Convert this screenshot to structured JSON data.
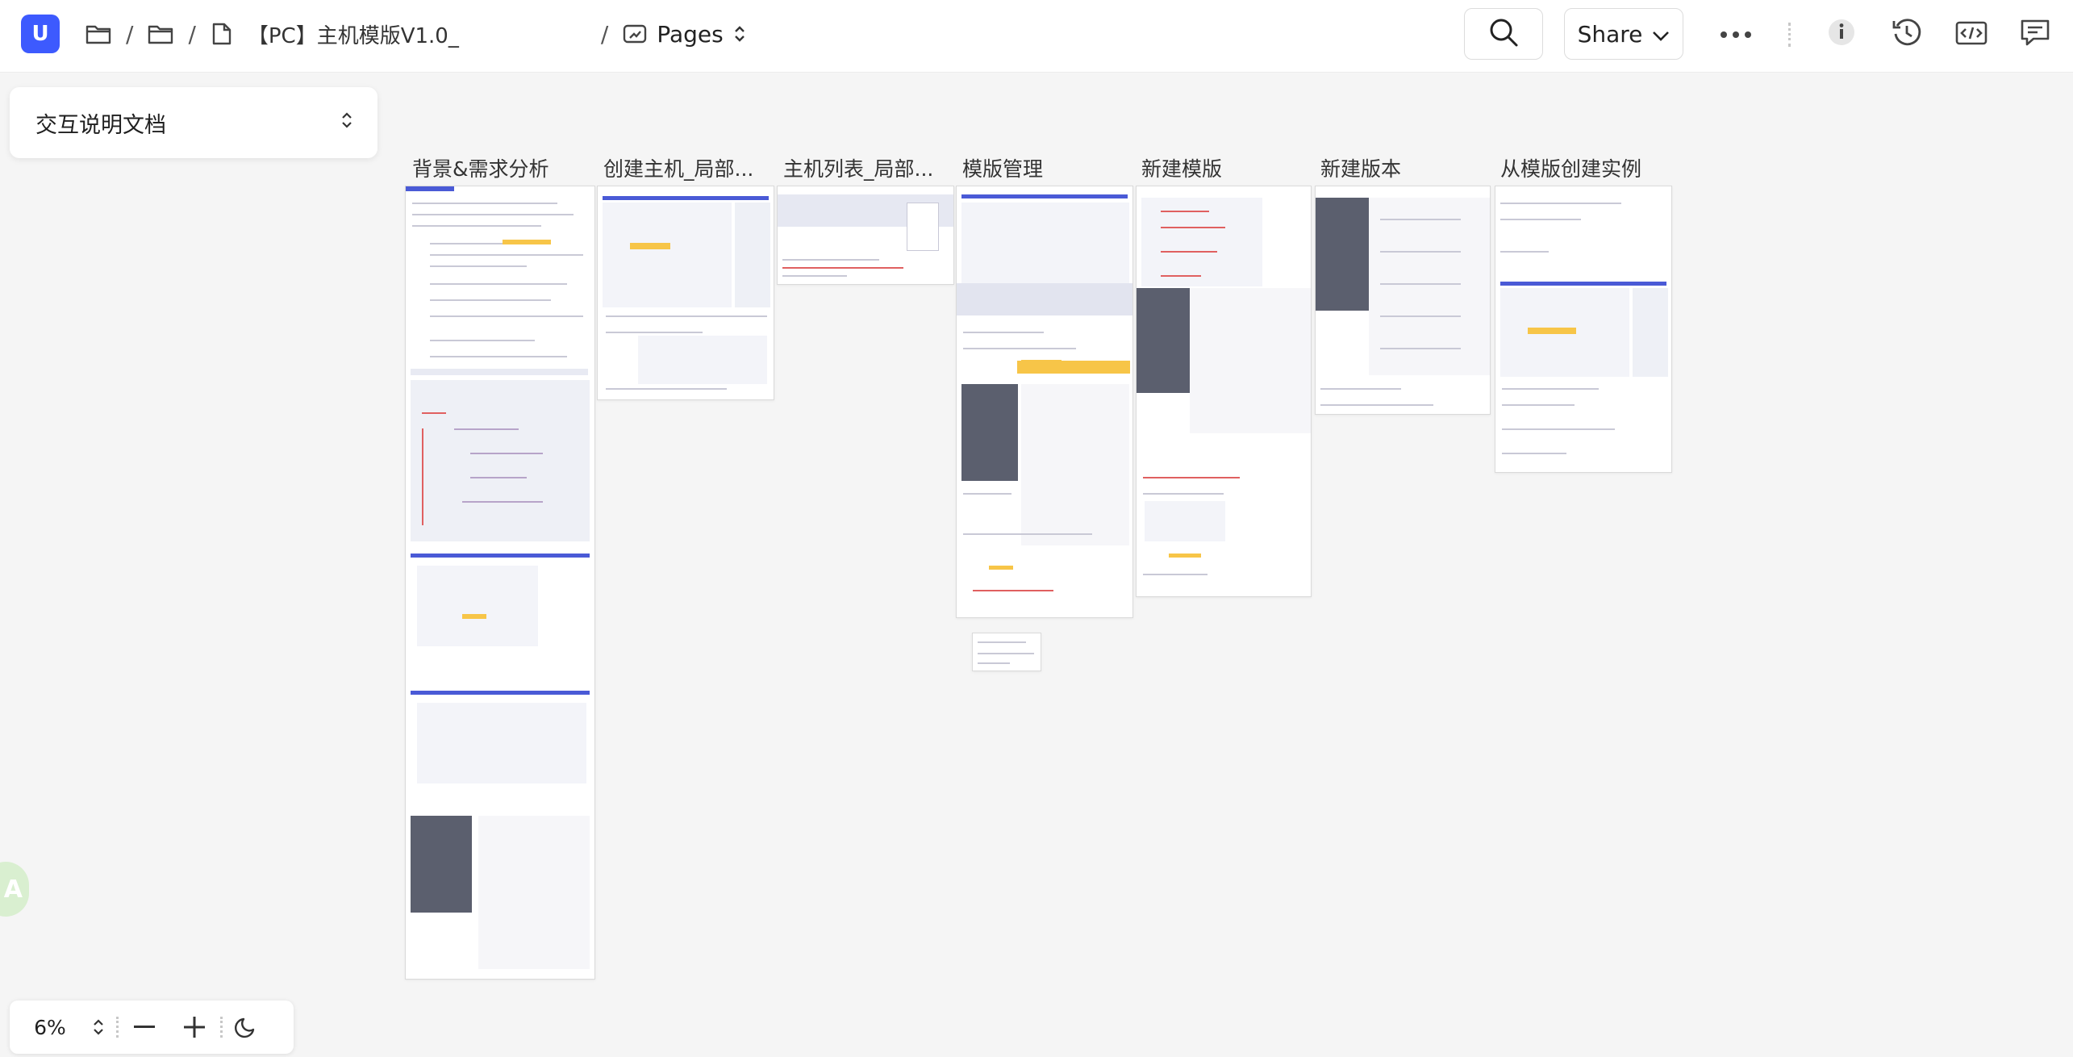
{
  "app": {
    "logo_letter": "U",
    "accent": "#3d5afe"
  },
  "breadcrumb": {
    "title": "【PC】主机模版V1.0_",
    "pages_label": "Pages"
  },
  "toolbar": {
    "share_label": "Share",
    "icons": [
      "search-icon",
      "chevron-down-icon",
      "more-icon",
      "info-icon",
      "history-icon",
      "code-icon",
      "comment-icon"
    ]
  },
  "sidepanel": {
    "selected_doc": "交互说明文档"
  },
  "frames": [
    {
      "title": "背景&需求分析"
    },
    {
      "title": "创建主机_局部..."
    },
    {
      "title": "主机列表_局部..."
    },
    {
      "title": "模版管理"
    },
    {
      "title": "新建模版"
    },
    {
      "title": "新建版本"
    },
    {
      "title": "从模版创建实例"
    }
  ],
  "zoom": {
    "level": "6%"
  }
}
